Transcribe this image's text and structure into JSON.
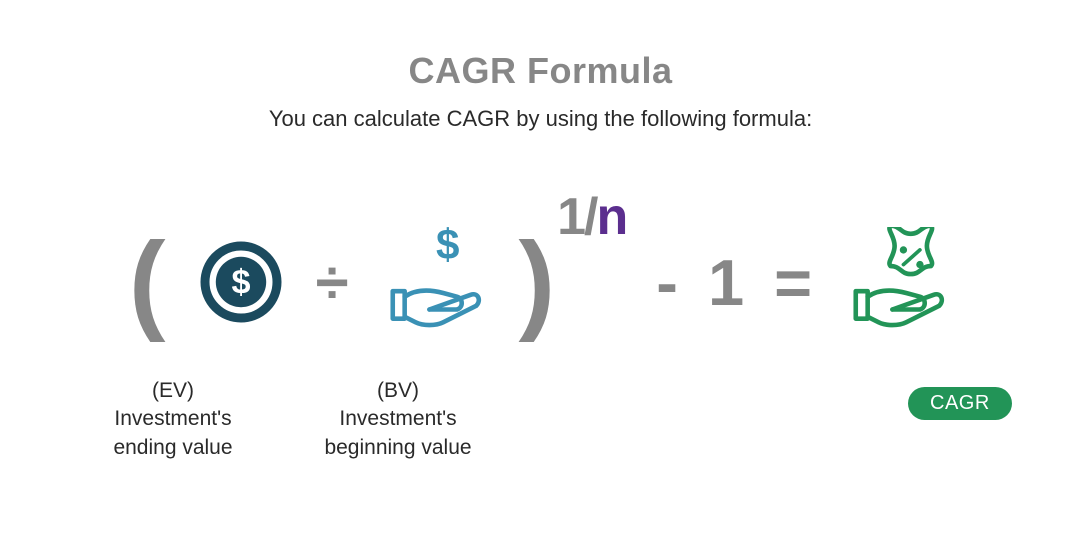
{
  "title": "CAGR Formula",
  "subtitle": "You can calculate CAGR by using the following formula:",
  "formula": {
    "open_paren": "(",
    "divide": "÷",
    "close_paren": ")",
    "exp_numer": "1/",
    "exp_n": "n",
    "minus": "-",
    "one": "1",
    "equals": "="
  },
  "labels": {
    "ev_short": "(EV)",
    "ev_line1": "Investment's",
    "ev_line2": "ending value",
    "bv_short": "(BV)",
    "bv_line1": "Investment's",
    "bv_line2": "beginning value",
    "cagr_badge": "CAGR"
  },
  "colors": {
    "title": "#878787",
    "operator": "#878787",
    "exp_n": "#5b2e8e",
    "coin": "#1b4a5e",
    "hand_money": "#3a91b5",
    "hand_percent": "#229457",
    "badge_bg": "#229457",
    "badge_fg": "#ffffff"
  },
  "icons": {
    "coin": "dollar-coin-icon",
    "hand_money": "hand-dollar-icon",
    "hand_percent": "hand-percent-icon"
  }
}
